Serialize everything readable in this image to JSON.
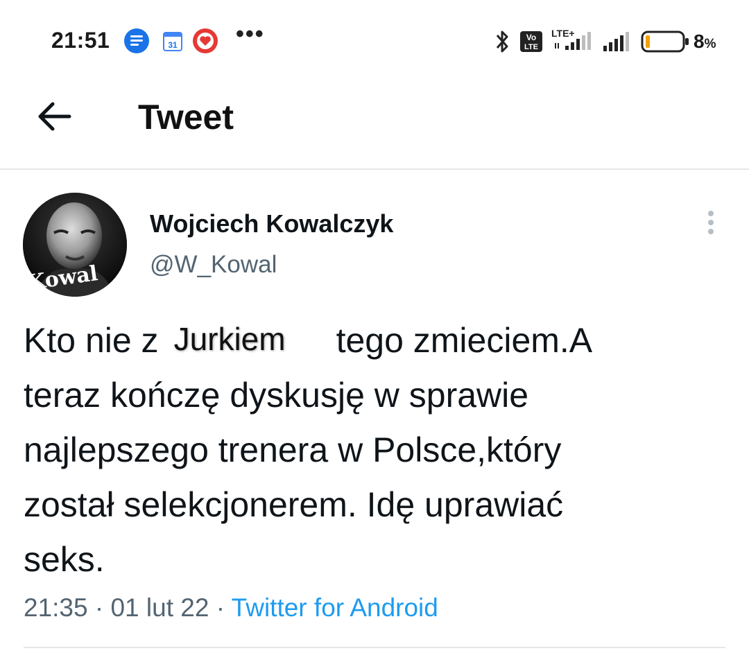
{
  "status_bar": {
    "time": "21:51",
    "battery_percent": "8",
    "battery_unit": "%",
    "calendar_day": "31",
    "network_tag": "LTE+",
    "volte_line1": "Vo",
    "volte_line2": "LTE",
    "notification_icons": [
      "messages-icon",
      "calendar-icon",
      "heart-app-icon"
    ],
    "more_indicator": "•••"
  },
  "header": {
    "title": "Tweet"
  },
  "tweet": {
    "author_name": "Wojciech Kowalczyk",
    "author_handle": "@W_Kowal",
    "avatar_overlay_text": "Kowal",
    "text_line1_before": "Kto nie z",
    "redacted_word": "Jurkiem",
    "text_line1_after": "tego zmieciem.A",
    "text_line2": "teraz kończę dyskusję w sprawie",
    "text_line3": "najlepszego trenera w Polsce,który",
    "text_line4": "został selekcjonerem. Idę uprawiać",
    "text_line5": "seks.",
    "time": "21:35",
    "separator": "·",
    "date": "01 lut 22",
    "source": "Twitter for Android"
  },
  "colors": {
    "text_primary": "#0f1419",
    "text_secondary": "#536471",
    "link": "#1d9bf0",
    "divider": "#e6e6e6",
    "battery_low": "#f4a100"
  }
}
